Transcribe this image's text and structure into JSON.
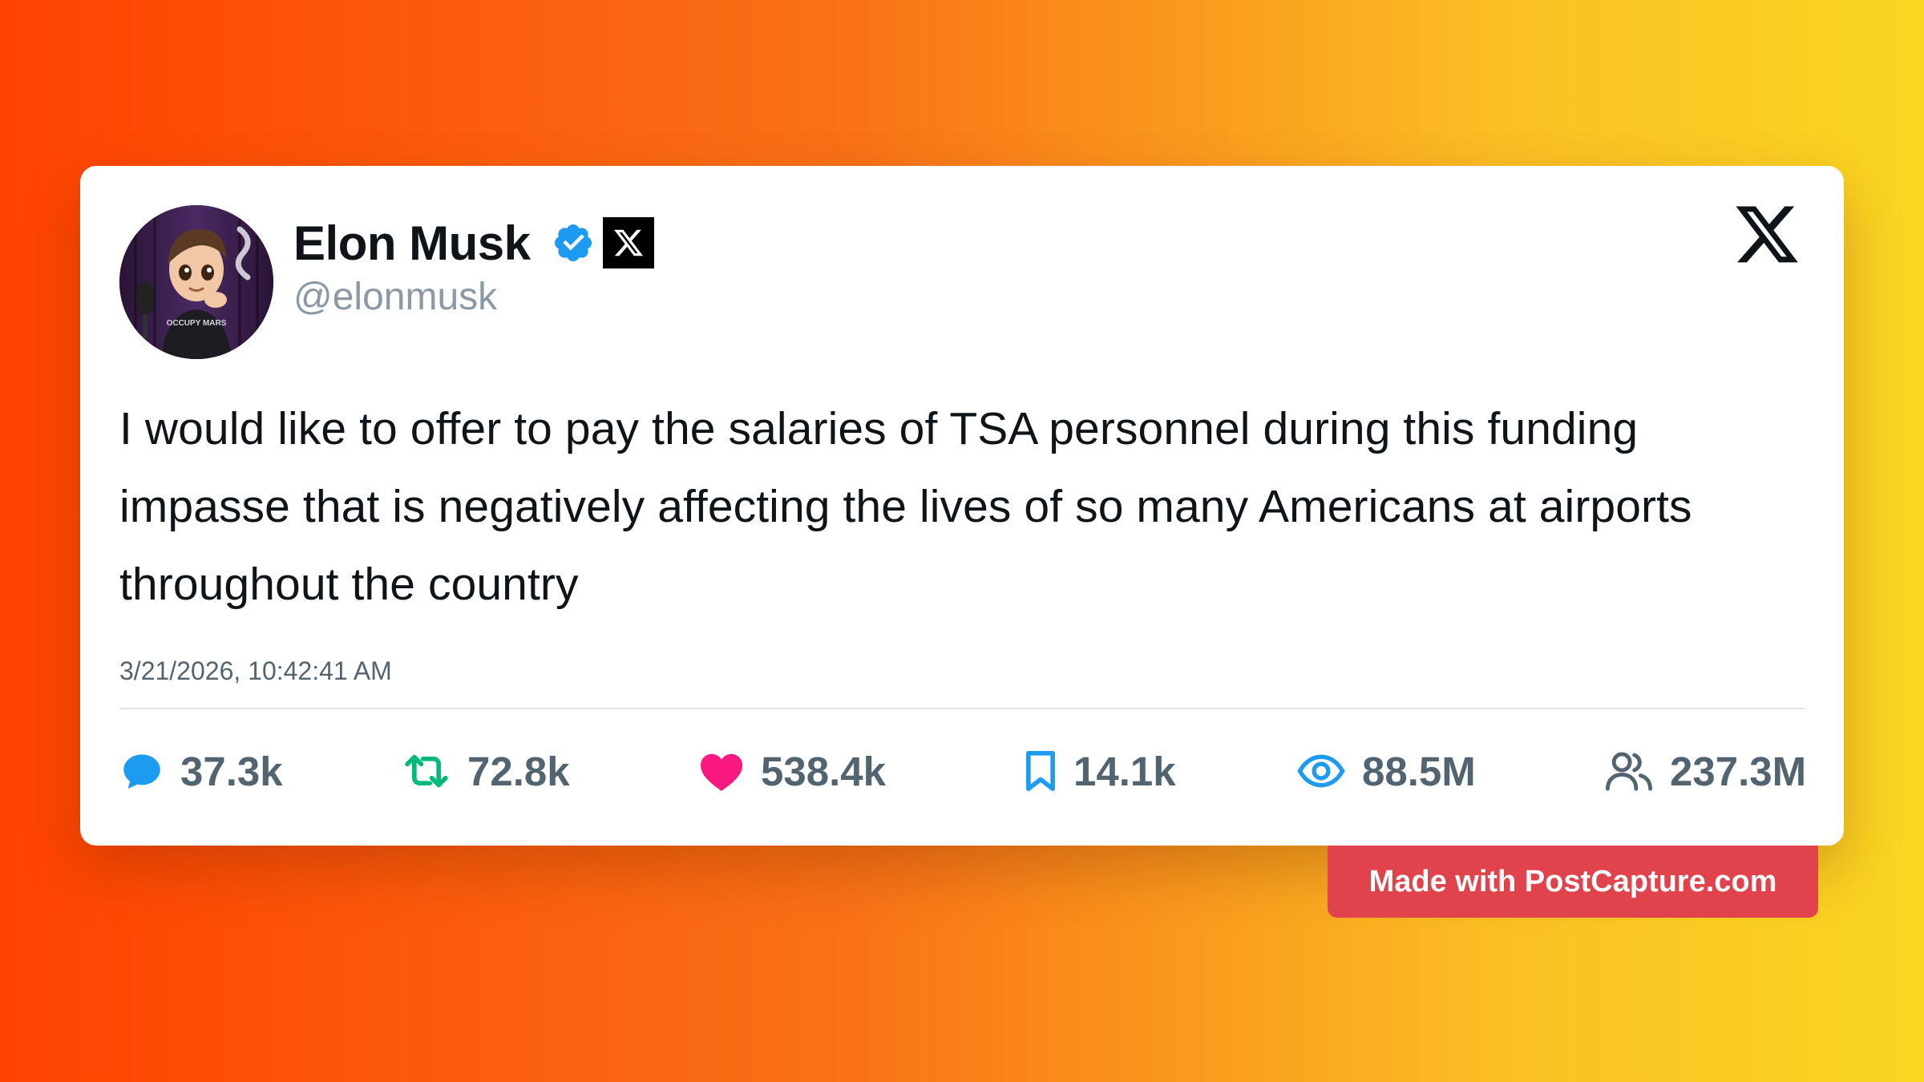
{
  "post": {
    "author_name": "Elon Musk",
    "author_handle": "@elonmusk",
    "text": "I would like to offer to pay the salaries of TSA personnel during this funding impasse that is negatively affecting the lives of so many Americans at airports throughout the country",
    "timestamp": "3/21/2026, 10:42:41 AM",
    "avatar_shirt_text": "OCCUPY MARS"
  },
  "stats": {
    "replies": "37.3k",
    "reposts": "72.8k",
    "likes": "538.4k",
    "bookmarks": "14.1k",
    "views": "88.5M",
    "followers": "237.3M"
  },
  "icons": {
    "verified": "verified-badge-icon",
    "affiliation": "x-affiliation-icon",
    "brand": "x-logo-icon",
    "replies": "reply-icon",
    "reposts": "repost-icon",
    "likes": "heart-icon",
    "bookmarks": "bookmark-icon",
    "views": "eye-icon",
    "followers": "followers-icon"
  },
  "colors": {
    "verified": "#1d9bf0",
    "reply": "#1d9bf0",
    "repost": "#00ba7c",
    "like": "#f91880",
    "bookmark": "#1d9bf0",
    "views": "#1d9bf0",
    "followers": "#536471",
    "watermark": "#e0434b"
  },
  "watermark": {
    "label": "Made with PostCapture.com"
  }
}
